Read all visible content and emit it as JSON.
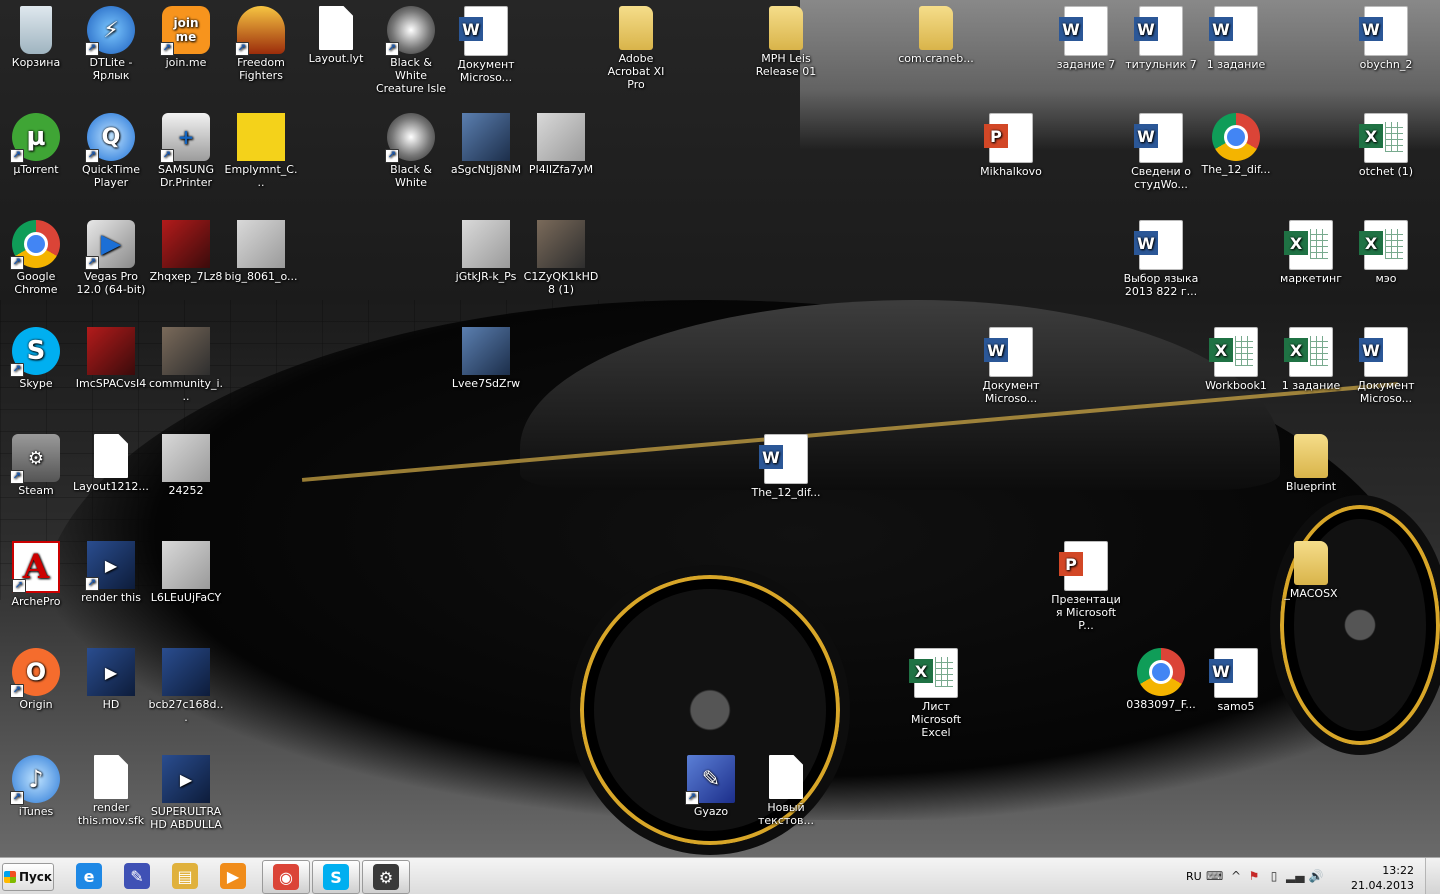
{
  "desktop": {
    "icons": [
      {
        "label": "Корзина",
        "icon": "recycle-bin-icon",
        "kind": "recycle",
        "glyph": "",
        "shortcut": false
      },
      {
        "label": "DTLite - Ярлык",
        "icon": "daemon-tools-icon",
        "kind": "dtlite",
        "glyph": "⚡",
        "shortcut": true
      },
      {
        "label": "join.me",
        "icon": "joinme-icon",
        "kind": "joinme",
        "glyph": "join me",
        "shortcut": true
      },
      {
        "label": "Freedom Fighters",
        "icon": "freedom-fighters-icon",
        "kind": "freedom",
        "glyph": "",
        "shortcut": true
      },
      {
        "label": "Layout.lyt",
        "icon": "blank-file-icon",
        "kind": "doc",
        "glyph": "",
        "shortcut": false
      },
      {
        "label": "Black & White Creature Isle",
        "icon": "black-white-icon",
        "kind": "bw",
        "glyph": "",
        "shortcut": true
      },
      {
        "label": "Документ Microso...",
        "icon": "word-document-icon",
        "kind": "word",
        "glyph": "",
        "shortcut": false
      },
      {
        "label": "Adobe Acrobat XI Pro",
        "icon": "folder-icon",
        "kind": "folder",
        "glyph": "",
        "shortcut": false
      },
      {
        "label": "MPH Leis Release 01",
        "icon": "folder-icon",
        "kind": "folder",
        "glyph": "",
        "shortcut": false
      },
      {
        "label": "com.craneb...",
        "icon": "folder-icon",
        "kind": "folder",
        "glyph": "",
        "shortcut": false
      },
      {
        "label": "задание 7",
        "icon": "word-document-icon",
        "kind": "word",
        "glyph": "",
        "shortcut": false
      },
      {
        "label": "титульник 7",
        "icon": "word-document-icon",
        "kind": "word",
        "glyph": "",
        "shortcut": false
      },
      {
        "label": "1 задание",
        "icon": "word-document-icon",
        "kind": "word",
        "glyph": "",
        "shortcut": false
      },
      {
        "label": "obychn_2",
        "icon": "word-document-icon",
        "kind": "word",
        "glyph": "",
        "shortcut": false
      },
      {
        "label": "µTorrent",
        "icon": "utorrent-icon",
        "kind": "utorrent",
        "glyph": "µ",
        "shortcut": true
      },
      {
        "label": "QuickTime Player",
        "icon": "quicktime-icon",
        "kind": "quicktime",
        "glyph": "Q",
        "shortcut": true
      },
      {
        "label": "SAMSUNG Dr.Printer",
        "icon": "samsung-printer-icon",
        "kind": "samsung",
        "glyph": "+",
        "shortcut": true
      },
      {
        "label": "Emplymnt_C...",
        "icon": "image-icon",
        "kind": "emply",
        "glyph": "",
        "shortcut": false
      },
      {
        "label": "Black & White",
        "icon": "black-white-icon",
        "kind": "bw",
        "glyph": "",
        "shortcut": true
      },
      {
        "label": "aSgcNtJj8NM",
        "icon": "image-icon",
        "kind": "photo blue",
        "glyph": "",
        "shortcut": false
      },
      {
        "label": "PI4IlZfa7yM",
        "icon": "image-icon",
        "kind": "photo light",
        "glyph": "",
        "shortcut": false
      },
      {
        "label": "Mikhalkovo",
        "icon": "powerpoint-icon",
        "kind": "ppt",
        "glyph": "",
        "shortcut": false
      },
      {
        "label": "Сведени о студWo...",
        "icon": "word-document-icon",
        "kind": "word",
        "glyph": "",
        "shortcut": false
      },
      {
        "label": "The_12_dif...",
        "icon": "chrome-html-icon",
        "kind": "chrome",
        "glyph": "",
        "shortcut": false
      },
      {
        "label": "otchet (1)",
        "icon": "excel-icon",
        "kind": "excel",
        "glyph": "",
        "shortcut": false
      },
      {
        "label": "Google Chrome",
        "icon": "chrome-icon",
        "kind": "chrome",
        "glyph": "",
        "shortcut": true
      },
      {
        "label": "Vegas Pro 12.0 (64-bit)",
        "icon": "vegas-icon",
        "kind": "vegas",
        "glyph": "▶",
        "shortcut": true
      },
      {
        "label": "Zhqxep_7Lz8",
        "icon": "image-icon",
        "kind": "photo red",
        "glyph": "",
        "shortcut": false
      },
      {
        "label": "big_8061_o...",
        "icon": "image-icon",
        "kind": "photo light",
        "glyph": "",
        "shortcut": false
      },
      {
        "label": "jGtkJR-k_Ps",
        "icon": "image-icon",
        "kind": "photo light",
        "glyph": "",
        "shortcut": false
      },
      {
        "label": "C1ZyQK1kHD8 (1)",
        "icon": "image-icon",
        "kind": "photo",
        "glyph": "",
        "shortcut": false
      },
      {
        "label": "Выбор языка 2013 822 г...",
        "icon": "word-document-icon",
        "kind": "word",
        "glyph": "",
        "shortcut": false
      },
      {
        "label": "маркетинг",
        "icon": "excel-icon",
        "kind": "excel",
        "glyph": "",
        "shortcut": false
      },
      {
        "label": "мэо",
        "icon": "excel-icon",
        "kind": "excel",
        "glyph": "",
        "shortcut": false
      },
      {
        "label": "Skype",
        "icon": "skype-icon",
        "kind": "skype",
        "glyph": "S",
        "shortcut": true
      },
      {
        "label": "ImcSPACvsI4",
        "icon": "image-icon",
        "kind": "photo red",
        "glyph": "",
        "shortcut": false
      },
      {
        "label": "community_i...",
        "icon": "image-icon",
        "kind": "photo",
        "glyph": "",
        "shortcut": false
      },
      {
        "label": "Lvee7SdZrw",
        "icon": "image-icon",
        "kind": "photo blue",
        "glyph": "",
        "shortcut": false
      },
      {
        "label": "Документ Microso...",
        "icon": "word-document-icon",
        "kind": "word",
        "glyph": "",
        "shortcut": false
      },
      {
        "label": "Workbook1",
        "icon": "excel-icon",
        "kind": "excel",
        "glyph": "",
        "shortcut": false
      },
      {
        "label": "1 задание",
        "icon": "excel-icon",
        "kind": "excel",
        "glyph": "",
        "shortcut": false
      },
      {
        "label": "Документ Microso...",
        "icon": "word-document-icon",
        "kind": "word",
        "glyph": "",
        "shortcut": false
      },
      {
        "label": "Steam",
        "icon": "steam-icon",
        "kind": "steam",
        "glyph": "⚙",
        "shortcut": true
      },
      {
        "label": "Layout1212...",
        "icon": "blank-file-icon",
        "kind": "doc",
        "glyph": "",
        "shortcut": false
      },
      {
        "label": "24252",
        "icon": "image-icon",
        "kind": "photo light",
        "glyph": "",
        "shortcut": false
      },
      {
        "label": "The_12_dif...",
        "icon": "word-document-icon",
        "kind": "word",
        "glyph": "",
        "shortcut": false
      },
      {
        "label": "Blueprint",
        "icon": "folder-icon",
        "kind": "folder",
        "glyph": "",
        "shortcut": false
      },
      {
        "label": "ArchePro",
        "icon": "archepro-icon",
        "kind": "archepro",
        "glyph": "A",
        "shortcut": true
      },
      {
        "label": "render this",
        "icon": "video-file-icon",
        "kind": "video",
        "glyph": "▶",
        "shortcut": true
      },
      {
        "label": "L6LEuUjFaCY",
        "icon": "image-icon",
        "kind": "photo light",
        "glyph": "",
        "shortcut": false
      },
      {
        "label": "Презентация Microsoft P...",
        "icon": "powerpoint-icon",
        "kind": "ppt",
        "glyph": "",
        "shortcut": false
      },
      {
        "label": "_MACOSX",
        "icon": "folder-icon",
        "kind": "folder",
        "glyph": "",
        "shortcut": false
      },
      {
        "label": "Origin",
        "icon": "origin-icon",
        "kind": "origin",
        "glyph": "O",
        "shortcut": true
      },
      {
        "label": "HD",
        "icon": "video-file-icon",
        "kind": "video",
        "glyph": "▶",
        "shortcut": false
      },
      {
        "label": "bcb27c168d...",
        "icon": "video-file-icon",
        "kind": "video",
        "glyph": "",
        "shortcut": false
      },
      {
        "label": "Лист Microsoft Excel",
        "icon": "excel-icon",
        "kind": "excel",
        "glyph": "",
        "shortcut": false
      },
      {
        "label": "0383097_F...",
        "icon": "chrome-html-icon",
        "kind": "chrome",
        "glyph": "",
        "shortcut": false
      },
      {
        "label": "samo5",
        "icon": "word-document-icon",
        "kind": "word",
        "glyph": "",
        "shortcut": false
      },
      {
        "label": "iTunes",
        "icon": "itunes-icon",
        "kind": "itunes",
        "glyph": "♪",
        "shortcut": true
      },
      {
        "label": "render this.mov.sfk",
        "icon": "blank-file-icon",
        "kind": "doc",
        "glyph": "",
        "shortcut": false
      },
      {
        "label": "SUPERULTRA HD ABDULLA",
        "icon": "video-file-icon",
        "kind": "video",
        "glyph": "▶",
        "shortcut": false
      },
      {
        "label": "Gyazo",
        "icon": "gyazo-icon",
        "kind": "gyazo",
        "glyph": "✎",
        "shortcut": true
      },
      {
        "label": "Новый текстов...",
        "icon": "text-file-icon",
        "kind": "doc",
        "glyph": "",
        "shortcut": false
      }
    ]
  },
  "taskbar": {
    "start_label": "Пуск",
    "pinned": [
      {
        "name": "internet-explorer",
        "icon": "internet-explorer-icon",
        "glyph": "e",
        "color": "#1e88e5"
      },
      {
        "name": "daemon-tools",
        "icon": "daemon-tools-icon",
        "glyph": "✎",
        "color": "#3f51b5"
      },
      {
        "name": "explorer",
        "icon": "file-explorer-icon",
        "glyph": "▤",
        "color": "#e0b13c"
      },
      {
        "name": "media-player",
        "icon": "media-player-icon",
        "glyph": "▶",
        "color": "#f08c1a"
      },
      {
        "name": "chrome",
        "icon": "chrome-icon",
        "glyph": "◉",
        "color": "#db4437"
      },
      {
        "name": "skype",
        "icon": "skype-icon",
        "glyph": "S",
        "color": "#00aff0"
      },
      {
        "name": "steam",
        "icon": "steam-icon",
        "glyph": "⚙",
        "color": "#3a3a3a"
      }
    ],
    "tray": {
      "language": "RU",
      "time": "13:22",
      "date": "21.04.2013"
    }
  }
}
